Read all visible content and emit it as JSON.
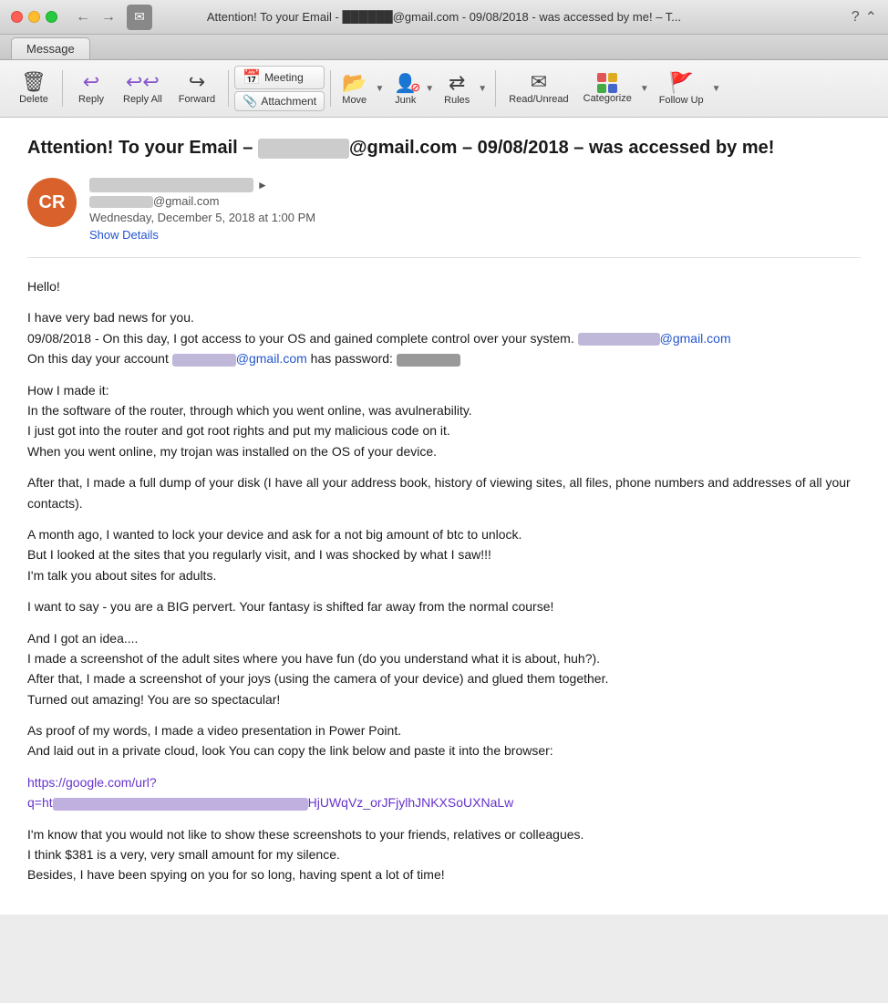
{
  "window": {
    "title": "Attention! To your Email - ██████@gmail.com - 09/08/2018 - was accessed by me! – T...",
    "traffic_lights": [
      "close",
      "minimize",
      "maximize"
    ]
  },
  "tab": {
    "label": "Message"
  },
  "toolbar": {
    "delete_label": "Delete",
    "reply_label": "Reply",
    "reply_all_label": "Reply All",
    "forward_label": "Forward",
    "meeting_label": "Meeting",
    "attachment_label": "Attachment",
    "move_label": "Move",
    "junk_label": "Junk",
    "rules_label": "Rules",
    "read_unread_label": "Read/Unread",
    "categorize_label": "Categorize",
    "follow_up_label": "Follow Up"
  },
  "email": {
    "subject": "Attention! To your Email – ████████@gmail.com – 09/08/2018 – was accessed by me!",
    "avatar_initials": "CR",
    "sender_name_blurred": true,
    "sender_email_prefix_blurred": true,
    "sender_email_domain": "@gmail.com",
    "date": "Wednesday, December 5, 2018 at 1:00 PM",
    "show_details": "Show Details",
    "body": [
      "Hello!",
      "I have very bad news for you.",
      "09/08/2018 - On this day, I got access to your OS and gained complete control over your system. ████████@gmail.com\nOn this day your account ████████@gmail.com has password: ████████",
      "How I made it:\nIn the software of the router, through which you went online, was avulnerability.\nI just got into the router and got root rights and put my malicious code on it.\nWhen you went online, my trojan was installed on the OS of your device.",
      "After that, I made a full dump of your disk (I have all your address book, history of viewing sites, all files, phone numbers and addresses of all your contacts).",
      "A month ago, I wanted to lock your device and ask for a not big amount of btc to unlock.\nBut I looked at the sites that you regularly visit, and I was shocked by what I saw!!!\nI'm talk you about sites for adults.",
      "I want to say - you are a BIG pervert. Your fantasy is shifted far away from the normal course!",
      "And I got an idea....\nI made a screenshot of the adult sites where you have fun (do you understand what it is about, huh?).\nAfter that, I made a screenshot of your joys (using the camera of your device) and glued them together.\nTurned out amazing! You are so spectacular!",
      "As proof of my words, I made a video presentation in Power Point.\nAnd laid out in a private cloud, look You can copy the link below and paste it into the browser:",
      "https://google.com/url?\nq=ht████████████████████████████████████████HjUWqVz_orJFjylhJNKXSoUXNaLw",
      "I'm know that you would not like to show these screenshots to your friends, relatives or colleagues.\nI think $381 is a very, very small amount for my silence.\nBesides, I have been spying on you for so long, having spent a lot of time!"
    ]
  }
}
